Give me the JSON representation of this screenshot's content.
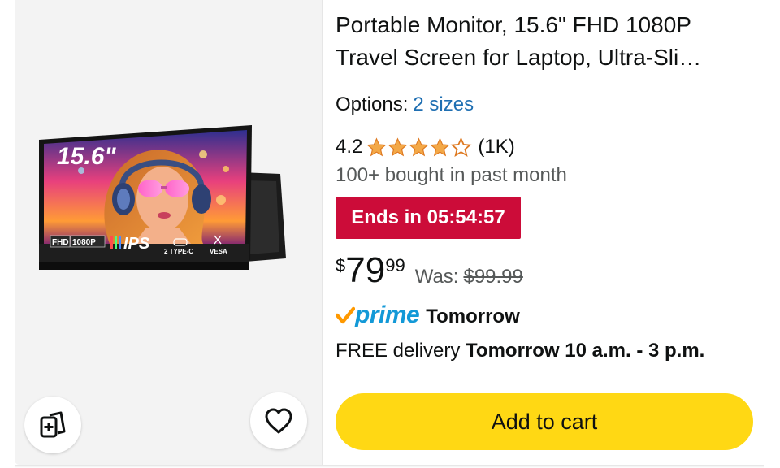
{
  "product": {
    "title": "Portable Monitor, 15.6\" FHD 1080P Travel Screen for Laptop, Ultra-Sli…",
    "image": {
      "screen_size_text": "15.6\"",
      "badge_fhd": "FHD",
      "badge_1080p": "1080P",
      "badge_ips": "IPS",
      "badge_type_c": "2 TYPE-C",
      "badge_vesa": "VESA"
    },
    "options_label": "Options:",
    "options_value": "2 sizes",
    "rating_value": "4.2",
    "rating_stars": 4.2,
    "rating_count": "(1K)",
    "bought_text": "100+ bought in past month",
    "deal_text": "Ends in 05:54:57",
    "price": {
      "symbol": "$",
      "whole": "79",
      "fraction": "99",
      "was_label": "Was:",
      "was_value": "$99.99"
    },
    "prime": {
      "logo_text": "prime",
      "delivery_day": "Tomorrow"
    },
    "delivery": {
      "prefix": "FREE delivery",
      "window": "Tomorrow 10 a.m. - 3 p.m."
    },
    "add_to_cart_label": "Add to cart"
  },
  "icons": {
    "compare": "compare-icon",
    "wishlist": "heart-icon",
    "star": "star-icon",
    "prime_check": "prime-check-icon"
  },
  "colors": {
    "deal_red": "#cc0c39",
    "star_orange": "#f3a847",
    "prime_blue": "#1399d7",
    "prime_check_orange": "#ff9900",
    "link_blue": "#1f6fb2",
    "cart_yellow": "#ffd814"
  }
}
